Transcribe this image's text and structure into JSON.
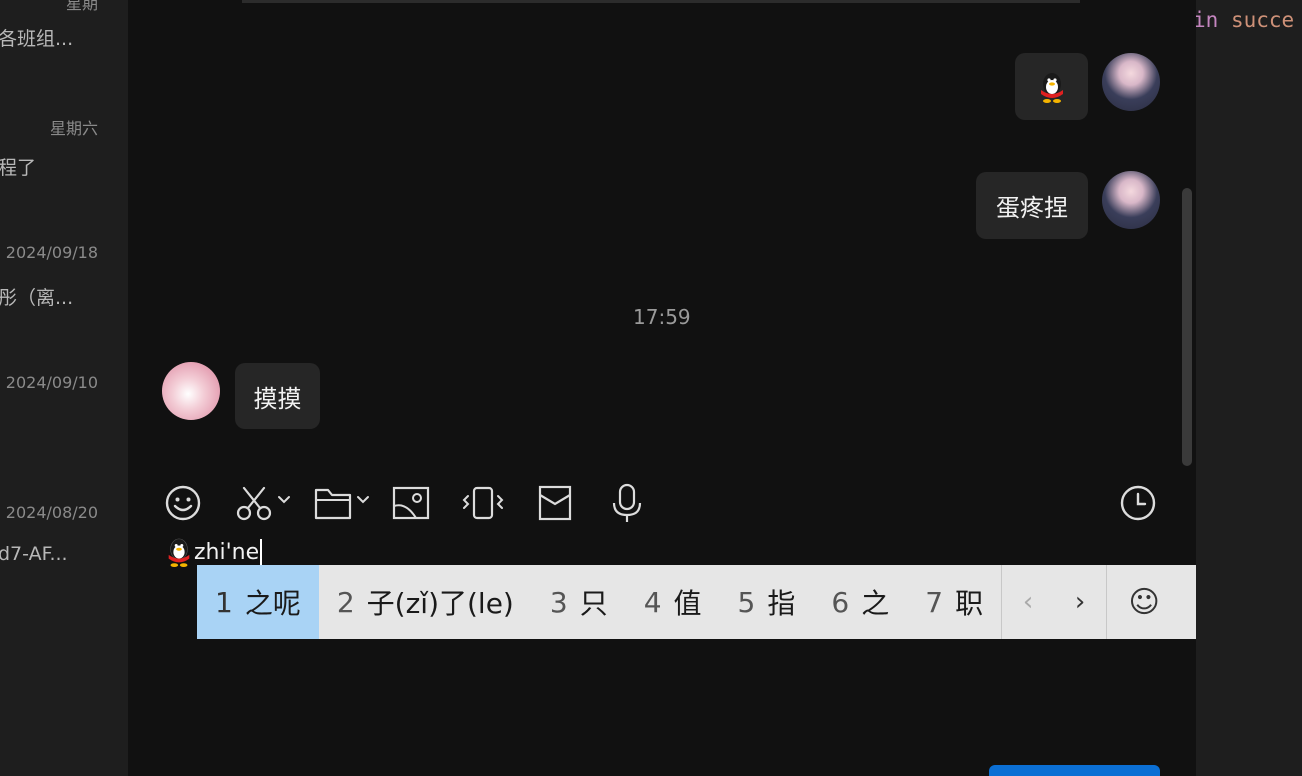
{
  "conversation_list": {
    "items": [
      {
        "date": "",
        "preview": "各班组..."
      },
      {
        "date": "星期六",
        "preview": "程了"
      },
      {
        "date": "2024/09/18",
        "preview": "彤（离..."
      },
      {
        "date": "2024/09/10",
        "preview": ""
      },
      {
        "date": "2024/08/20",
        "preview": "d7-AF..."
      }
    ]
  },
  "messages": [
    {
      "sender": "self",
      "type": "emoji",
      "icon": "qq-penguin-icon"
    },
    {
      "sender": "self",
      "type": "text",
      "text": "蛋疼捏"
    },
    {
      "type": "timestamp",
      "text": "17:59"
    },
    {
      "sender": "other",
      "type": "text",
      "text": "摸摸"
    }
  ],
  "toolbar": {
    "items": [
      "emoji-icon",
      "screenshot-scissors-icon",
      "folder-icon",
      "image-icon",
      "shake-window-icon",
      "red-packet-icon",
      "microphone-icon",
      "history-clock-icon"
    ]
  },
  "input": {
    "emoji": "qq-penguin-icon",
    "text": "zhi'ne"
  },
  "ime": {
    "candidates": [
      {
        "num": "1",
        "text": "之呢",
        "selected": true
      },
      {
        "num": "2",
        "text": "子(zǐ)了(le)"
      },
      {
        "num": "3",
        "text": "只"
      },
      {
        "num": "4",
        "text": "值"
      },
      {
        "num": "5",
        "text": "指"
      },
      {
        "num": "6",
        "text": "之"
      },
      {
        "num": "7",
        "text": "职"
      }
    ],
    "prev": "‹",
    "next": "›",
    "emoji_symbol": "☺"
  },
  "code_panel": {
    "keyword": "in",
    "word": "succe"
  },
  "colors": {
    "background": "#111111",
    "bubble": "#262626",
    "ime_selected": "#a9d3f5",
    "send_button": "#0b6fd4"
  }
}
